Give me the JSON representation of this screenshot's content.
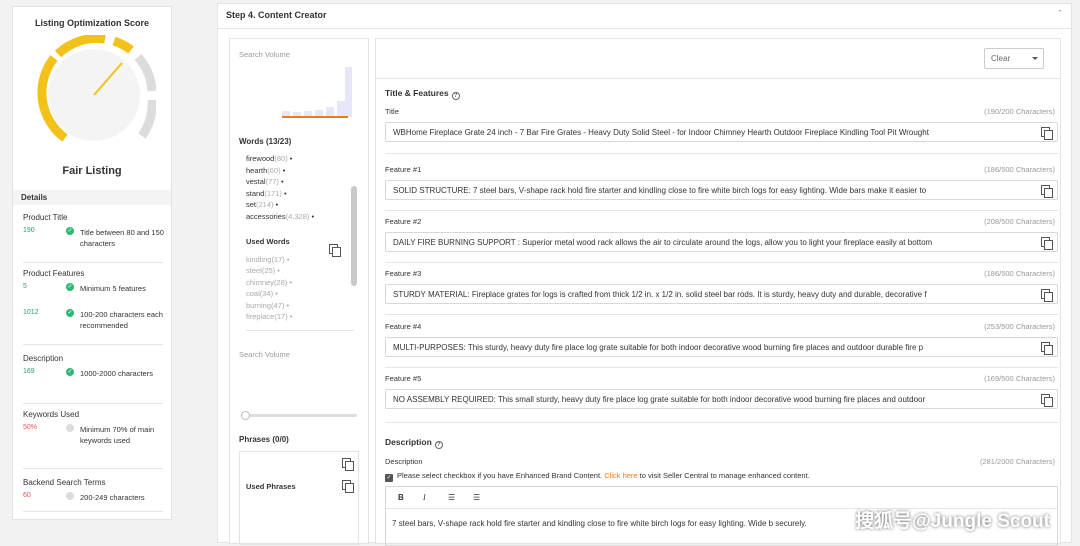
{
  "score": {
    "title": "Listing Optimization Score",
    "rating": "Fair Listing",
    "details_label": "Details"
  },
  "details": [
    {
      "label": "Product Title",
      "rows": [
        {
          "num": "190",
          "status": "ok",
          "text": "Title between 80 and 150 characters"
        }
      ]
    },
    {
      "label": "Product Features",
      "rows": [
        {
          "num": "5",
          "status": "ok",
          "text": "Minimum 5 features"
        },
        {
          "num": "1012",
          "status": "ok",
          "text": "100-200 characters each recommended"
        }
      ]
    },
    {
      "label": "Description",
      "rows": [
        {
          "num": "169",
          "status": "ok",
          "text": "1000-2000 characters"
        }
      ]
    },
    {
      "label": "Keywords Used",
      "rows": [
        {
          "num": "50%",
          "status": "warn",
          "text": "Minimum 70% of main keywords used"
        }
      ]
    },
    {
      "label": "Backend Search Terms",
      "rows": [
        {
          "num": "60",
          "status": "warn",
          "text": "200-249 characters"
        }
      ]
    }
  ],
  "step": {
    "title": "Step 4. Content Creator"
  },
  "sidebar": {
    "search_volume_1": "Search Volume",
    "words_header": "Words (13/23)",
    "words": [
      {
        "w": "firewood",
        "c": "(80)"
      },
      {
        "w": "hearth",
        "c": "(60)"
      },
      {
        "w": "vestal",
        "c": "(77)"
      },
      {
        "w": "stand",
        "c": "(171)"
      },
      {
        "w": "set",
        "c": "(214)"
      },
      {
        "w": "accessories",
        "c": "(4,328)"
      }
    ],
    "used_words_header": "Used Words",
    "used_words": [
      {
        "w": "kindling",
        "c": "(17)"
      },
      {
        "w": "steel",
        "c": "(25)"
      },
      {
        "w": "chimney",
        "c": "(28)"
      },
      {
        "w": "coal",
        "c": "(34)"
      },
      {
        "w": "burning",
        "c": "(47)"
      },
      {
        "w": "fireplace",
        "c": "(17)"
      }
    ],
    "search_volume_2": "Search Volume",
    "phrases_header": "Phrases (0/0)",
    "used_phrases_header": "Used Phrases"
  },
  "editor": {
    "clear_label": "Clear",
    "title_features_header": "Title & Features",
    "fields": [
      {
        "label": "Title",
        "count": "(190/200 Characters)",
        "value": "WBHome Fireplace Grate 24 inch - 7 Bar Fire Grates - Heavy Duty Solid Steel - for Indoor Chimney Hearth Outdoor Fireplace Kindling Tool Pit Wrought"
      },
      {
        "label": "Feature #1",
        "count": "(186/500 Characters)",
        "value": "SOLID STRUCTURE: 7 steel bars, V-shape rack hold fire starter and kindling close to fire white birch logs for easy lighting. Wide bars make it easier to"
      },
      {
        "label": "Feature #2",
        "count": "(208/500 Characters)",
        "value": "DAILY FIRE BURNING SUPPORT :  Superior metal wood rack allows the air to circulate around the logs, allow you to light your fireplace easily at bottom"
      },
      {
        "label": "Feature #3",
        "count": "(186/500 Characters)",
        "value": "STURDY MATERIAL: Fireplace grates for logs is crafted from thick 1/2 in. x 1/2 in. solid steel bar rods. It is sturdy, heavy duty and durable, decorative f"
      },
      {
        "label": "Feature #4",
        "count": "(253/500 Characters)",
        "value": "MULTI-PURPOSES: This sturdy, heavy duty fire place log grate suitable for both indoor decorative wood burning fire places and outdoor durable fire p"
      },
      {
        "label": "Feature #5",
        "count": "(169/500 Characters)",
        "value": "NO ASSEMBLY REQUIRED: This small sturdy, heavy duty fire place log grate suitable for both indoor decorative wood burning fire places and outdoor"
      }
    ],
    "description_header": "Description",
    "description_label": "Description",
    "description_count": "(281/2000 Characters)",
    "checkbox_text": "Please select checkbox if you have Enhanced Brand Content.",
    "checkbox_link": "Click here",
    "checkbox_tail": "to visit Seller Central to manage enhanced content.",
    "toolbar": {
      "bold": "B",
      "italic": "I"
    },
    "description_text": "7 steel bars, V-shape rack hold fire starter and kindling close to fire white birch logs for easy lighting. Wide b securely."
  },
  "watermark": "搜狐号@Jungle Scout",
  "colors": {
    "gauge": "#f2c21b",
    "ok": "#2eb872",
    "link": "#f07a18"
  },
  "gauge_level": 0.55
}
